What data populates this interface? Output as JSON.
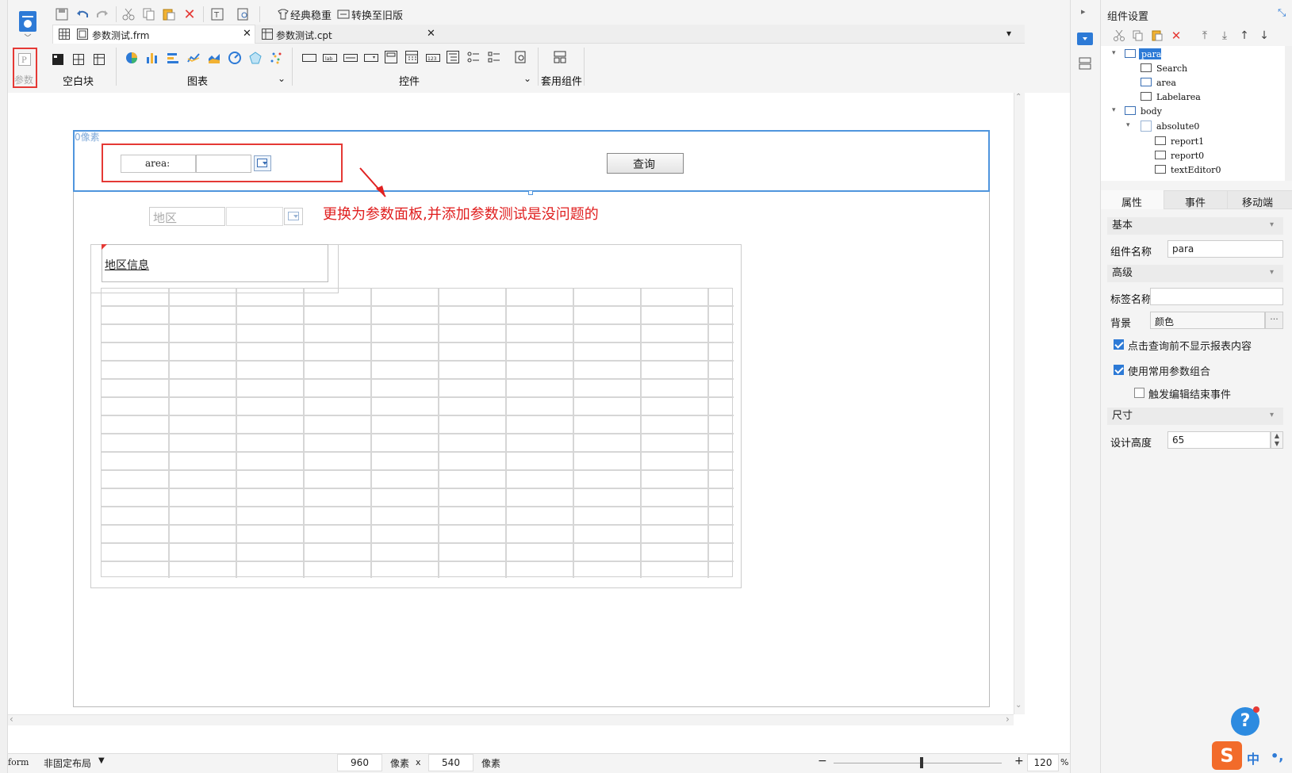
{
  "toolbar": {
    "classic_label": "经典稳重",
    "convert_label": "转换至旧版"
  },
  "tabs": [
    {
      "label": "参数测试.frm"
    },
    {
      "label": "参数测试.cpt"
    }
  ],
  "ribbon": {
    "param_label": "参数",
    "blank_label": "空白块",
    "chart_label": "图表",
    "control_label": "控件",
    "common_label": "套用组件"
  },
  "canvas": {
    "ruler_label": "0像素",
    "area_label": "area:",
    "query_button": "查询",
    "annotation": "更换为参数面板,并添加参数测试是没问题的",
    "region_label": "地区",
    "info_label": "地区信息"
  },
  "right_panel": {
    "title": "组件设置",
    "tree": [
      "para",
      "Search",
      "area",
      "Labelarea",
      "body",
      "absolute0",
      "report1",
      "report0",
      "textEditor0"
    ],
    "tabs": [
      "属性",
      "事件",
      "移动端"
    ],
    "sections": {
      "basic": "基本",
      "advanced": "高级",
      "size": "尺寸"
    },
    "component_name_label": "组件名称",
    "component_name_value": "para",
    "tag_name_label": "标签名称",
    "background_label": "背景",
    "background_value": "颜色",
    "chk1": "点击查询前不显示报表内容",
    "chk2": "使用常用参数组合",
    "chk3": "触发编辑结束事件",
    "height_label": "设计高度",
    "height_value": "65"
  },
  "status": {
    "mode": "form",
    "layout": "非固定布局",
    "width": "960",
    "unit1": "像素",
    "x": "x",
    "height": "540",
    "unit2": "像素",
    "zoom": "120",
    "percent": "%"
  },
  "colors": {
    "accent": "#2d7ad6",
    "highlight": "#e53935",
    "annotation": "#e02020"
  }
}
